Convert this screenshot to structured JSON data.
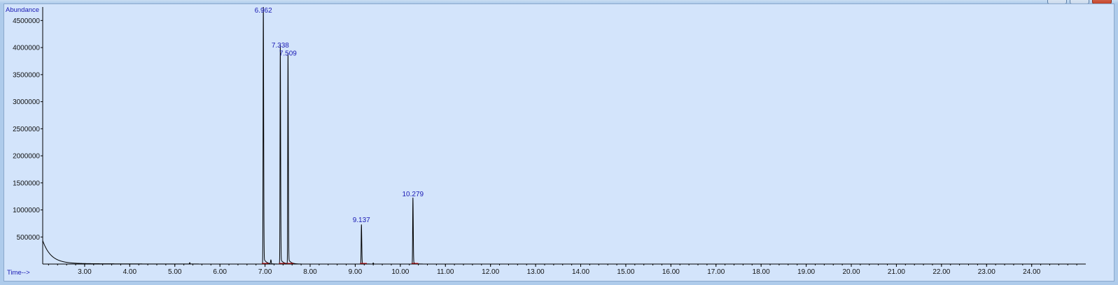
{
  "chart_data": {
    "type": "line",
    "title": "",
    "ylabel": "Abundance",
    "xlabel": "Time-->",
    "xlim": [
      2.07,
      25.2
    ],
    "ylim": [
      0,
      4750000
    ],
    "yticks": [
      500000,
      1000000,
      1500000,
      2000000,
      2500000,
      3000000,
      3500000,
      4000000,
      4500000
    ],
    "ytick_labels": [
      "500000",
      "1000000",
      "1500000",
      "2000000",
      "2500000",
      "3000000",
      "3500000",
      "4000000",
      "4500000"
    ],
    "xticks": [
      3,
      4,
      5,
      6,
      7,
      8,
      9,
      10,
      11,
      12,
      13,
      14,
      15,
      16,
      17,
      18,
      19,
      20,
      21,
      22,
      23,
      24
    ],
    "xtick_labels": [
      "3.00",
      "4.00",
      "5.00",
      "6.00",
      "7.00",
      "8.00",
      "9.00",
      "10.00",
      "11.00",
      "12.00",
      "13.00",
      "14.00",
      "15.00",
      "16.00",
      "17.00",
      "18.00",
      "19.00",
      "20.00",
      "21.00",
      "22.00",
      "23.00",
      "24.00"
    ],
    "grid": false,
    "line_color": "#000000",
    "label_color": "#1a1ab4",
    "baseline_color": "#d01010",
    "background_color": "#d3e4fb",
    "peaks": [
      {
        "label": "6.962",
        "x": 6.962,
        "y": 4700000
      },
      {
        "label": "7.338",
        "x": 7.338,
        "y": 3950000
      },
      {
        "label": "7.509",
        "x": 7.509,
        "y": 3800000
      },
      {
        "label": "9.137",
        "x": 9.137,
        "y": 720000
      },
      {
        "label": "10.279",
        "x": 10.279,
        "y": 1200000
      }
    ],
    "minor_peaks": [
      {
        "x": 5.33,
        "y": 25000
      },
      {
        "x": 7.13,
        "y": 70000
      },
      {
        "x": 9.4,
        "y": 20000
      }
    ],
    "initial_decay": {
      "x_start": 2.07,
      "y_start": 420000
    }
  }
}
